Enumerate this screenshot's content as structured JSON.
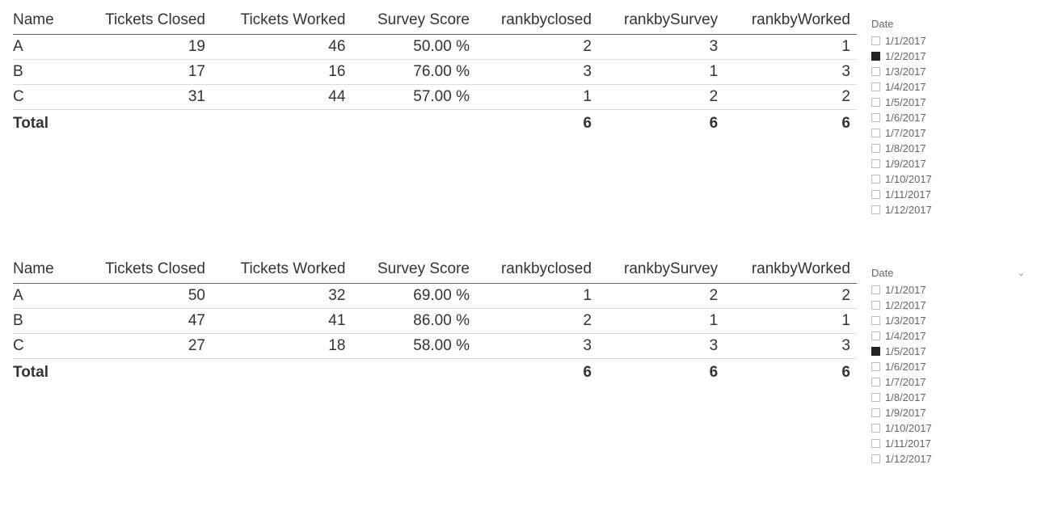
{
  "columns": {
    "name": "Name",
    "closed": "Tickets Closed",
    "worked": "Tickets Worked",
    "survey": "Survey Score",
    "rankClosed": "rankbyclosed",
    "rankSurvey": "rankbySurvey",
    "rankWorked": "rankbyWorked"
  },
  "totalLabel": "Total",
  "table1": {
    "rows": [
      {
        "name": "A",
        "closed": "19",
        "worked": "46",
        "survey": "50.00 %",
        "rankClosed": "2",
        "rankSurvey": "3",
        "rankWorked": "1"
      },
      {
        "name": "B",
        "closed": "17",
        "worked": "16",
        "survey": "76.00 %",
        "rankClosed": "3",
        "rankSurvey": "1",
        "rankWorked": "3"
      },
      {
        "name": "C",
        "closed": "31",
        "worked": "44",
        "survey": "57.00 %",
        "rankClosed": "1",
        "rankSurvey": "2",
        "rankWorked": "2"
      }
    ],
    "total": {
      "rankClosed": "6",
      "rankSurvey": "6",
      "rankWorked": "6"
    }
  },
  "table2": {
    "rows": [
      {
        "name": "A",
        "closed": "50",
        "worked": "32",
        "survey": "69.00 %",
        "rankClosed": "1",
        "rankSurvey": "2",
        "rankWorked": "2"
      },
      {
        "name": "B",
        "closed": "47",
        "worked": "41",
        "survey": "86.00 %",
        "rankClosed": "2",
        "rankSurvey": "1",
        "rankWorked": "1"
      },
      {
        "name": "C",
        "closed": "27",
        "worked": "18",
        "survey": "58.00 %",
        "rankClosed": "3",
        "rankSurvey": "3",
        "rankWorked": "3"
      }
    ],
    "total": {
      "rankClosed": "6",
      "rankSurvey": "6",
      "rankWorked": "6"
    }
  },
  "slicer1": {
    "title": "Date",
    "showChevron": false,
    "items": [
      {
        "label": "1/1/2017",
        "checked": false
      },
      {
        "label": "1/2/2017",
        "checked": true
      },
      {
        "label": "1/3/2017",
        "checked": false
      },
      {
        "label": "1/4/2017",
        "checked": false
      },
      {
        "label": "1/5/2017",
        "checked": false
      },
      {
        "label": "1/6/2017",
        "checked": false
      },
      {
        "label": "1/7/2017",
        "checked": false
      },
      {
        "label": "1/8/2017",
        "checked": false
      },
      {
        "label": "1/9/2017",
        "checked": false
      },
      {
        "label": "1/10/2017",
        "checked": false
      },
      {
        "label": "1/11/2017",
        "checked": false
      },
      {
        "label": "1/12/2017",
        "checked": false
      }
    ]
  },
  "slicer2": {
    "title": "Date",
    "showChevron": true,
    "items": [
      {
        "label": "1/1/2017",
        "checked": false
      },
      {
        "label": "1/2/2017",
        "checked": false
      },
      {
        "label": "1/3/2017",
        "checked": false
      },
      {
        "label": "1/4/2017",
        "checked": false
      },
      {
        "label": "1/5/2017",
        "checked": true
      },
      {
        "label": "1/6/2017",
        "checked": false
      },
      {
        "label": "1/7/2017",
        "checked": false
      },
      {
        "label": "1/8/2017",
        "checked": false
      },
      {
        "label": "1/9/2017",
        "checked": false
      },
      {
        "label": "1/10/2017",
        "checked": false
      },
      {
        "label": "1/11/2017",
        "checked": false
      },
      {
        "label": "1/12/2017",
        "checked": false
      }
    ]
  }
}
